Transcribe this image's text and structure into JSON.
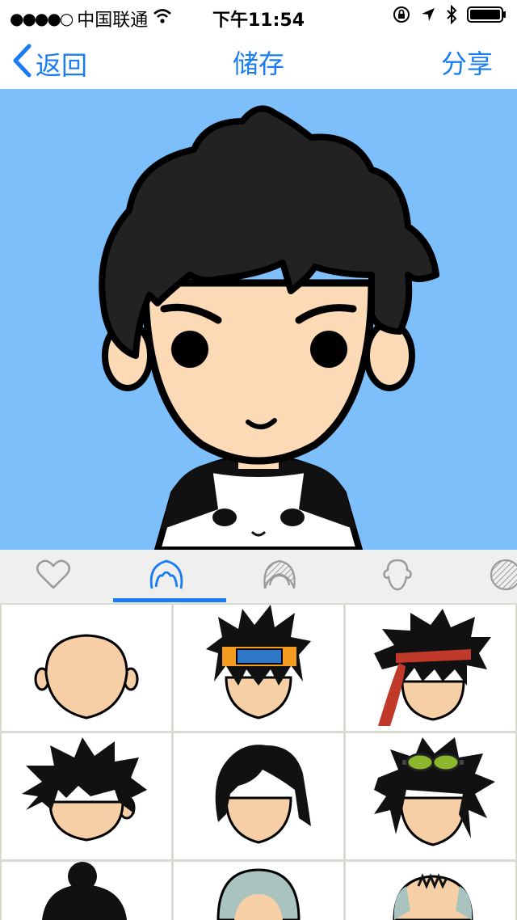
{
  "status_bar": {
    "signal_dots": "●●●●○",
    "carrier": "中国联通",
    "time": "下午11:54",
    "icons": [
      "wifi-icon",
      "orientation-lock-icon",
      "location-arrow-icon",
      "bluetooth-icon",
      "battery-icon"
    ]
  },
  "nav": {
    "back_label": "返回",
    "title": "储存",
    "share_label": "分享"
  },
  "colors": {
    "accent": "#1a7cf2",
    "avatar_background": "#7dbffa",
    "tab_bar_background": "#efeff0",
    "skin": "#fcdab6",
    "hair": "#222222"
  },
  "tabs": [
    {
      "icon": "heart-icon",
      "selected": false
    },
    {
      "icon": "hairstyle-icon",
      "selected": true
    },
    {
      "icon": "hair-color-icon",
      "selected": false
    },
    {
      "icon": "face-shape-icon",
      "selected": false
    },
    {
      "icon": "pattern-icon",
      "selected": false
    }
  ],
  "hair_options": [
    {
      "name": "bald"
    },
    {
      "name": "spiky-headband"
    },
    {
      "name": "wild-red-bandana"
    },
    {
      "name": "messy-black"
    },
    {
      "name": "side-part"
    },
    {
      "name": "spiky-goggles"
    },
    {
      "name": "bun"
    },
    {
      "name": "gray-short"
    },
    {
      "name": "gray-balding"
    }
  ]
}
